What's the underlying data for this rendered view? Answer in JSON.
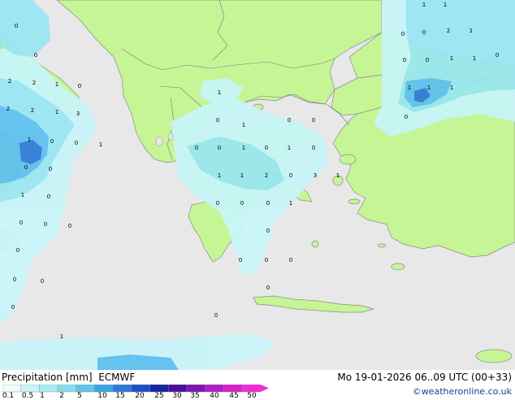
{
  "map": {
    "colors": {
      "sea": "#e8e8e8",
      "land": "#c6f596",
      "coast": "#8a8a8a",
      "border": "#777777",
      "precip_light": "#c8f5fa",
      "precip_mid": "#98e6f2",
      "precip_heavy": "#5cbff0",
      "precip_core": "#2a7ad8"
    },
    "values": [
      "0",
      "0",
      "2",
      "2",
      "1",
      "0",
      "2",
      "2",
      "1",
      "3",
      "1",
      "0",
      "0",
      "1",
      "0",
      "0",
      "1",
      "0",
      "0",
      "0",
      "0",
      "0",
      "1",
      "0",
      "0",
      "1",
      "0",
      "1",
      "0",
      "0",
      "0",
      "1",
      "0",
      "1",
      "1",
      "2",
      "0",
      "3",
      "1",
      "0",
      "0",
      "0",
      "0",
      "1",
      "0",
      "0",
      "0",
      "0",
      "0",
      "0",
      "0",
      "0",
      "1",
      "1",
      "1",
      "0",
      "0",
      "2",
      "1",
      "0",
      "0",
      "1",
      "1",
      "0",
      "1",
      "1",
      "1",
      "0"
    ]
  },
  "footer": {
    "title_left": "Precipitation [mm]  ECMWF",
    "title_right": "Mo 19-01-2026 06..09 UTC (00+33)",
    "credit": "©weatheronline.co.uk",
    "legend_labels": [
      "0.1",
      "0.5",
      "1",
      "2",
      "5",
      "10",
      "15",
      "20",
      "25",
      "30",
      "35",
      "40",
      "45",
      "50"
    ],
    "legend_colors": [
      "#f0fbfd",
      "#c8f5fa",
      "#a8ecf5",
      "#88dcef",
      "#62c6ea",
      "#3da5e2",
      "#2a7ad8",
      "#1d4fc2",
      "#10289f",
      "#4b0f9a",
      "#7d14b3",
      "#b21bc9",
      "#d821c6",
      "#f32ad8"
    ]
  }
}
